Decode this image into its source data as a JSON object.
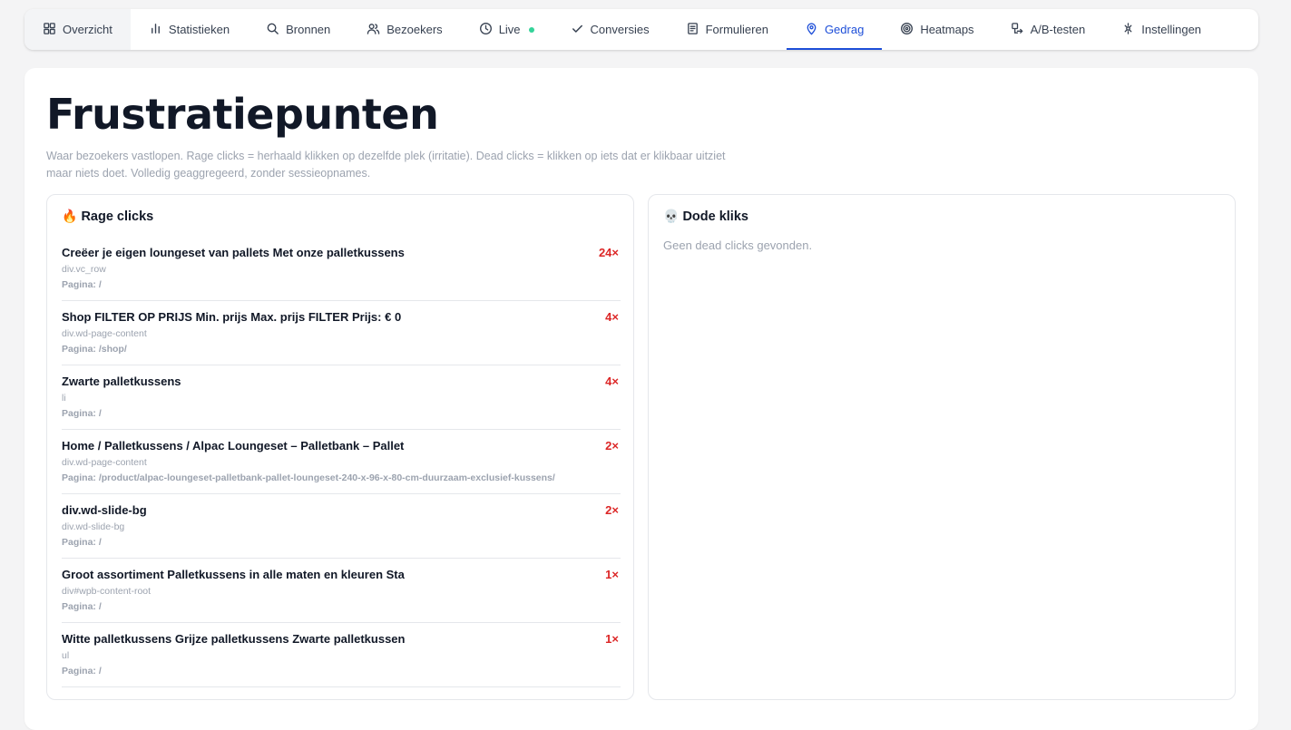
{
  "nav": {
    "tabs": [
      {
        "label": "Overzicht",
        "icon": "grid-icon"
      },
      {
        "label": "Statistieken",
        "icon": "bar-chart-icon"
      },
      {
        "label": "Bronnen",
        "icon": "search-icon"
      },
      {
        "label": "Bezoekers",
        "icon": "users-icon"
      },
      {
        "label": "Live",
        "icon": "clock-icon"
      },
      {
        "label": "Conversies",
        "icon": "check-icon"
      },
      {
        "label": "Formulieren",
        "icon": "form-icon"
      },
      {
        "label": "Gedrag",
        "icon": "map-pin-icon"
      },
      {
        "label": "Heatmaps",
        "icon": "target-icon"
      },
      {
        "label": "A/B-testen",
        "icon": "ab-test-icon"
      },
      {
        "label": "Instellingen",
        "icon": "settings-icon"
      }
    ],
    "active": "Gedrag"
  },
  "page": {
    "title": "Frustratiepunten",
    "description": "Waar bezoekers vastlopen. Rage clicks = herhaald klikken op dezelfde plek (irritatie). Dead clicks = klikken op iets dat er klikbaar uitziet maar niets doet. Volledig geaggregeerd, zonder sessieopnames."
  },
  "rage": {
    "emoji": "🔥",
    "title": "Rage clicks",
    "items": [
      {
        "text": "Creëer je eigen loungeset van pallets Met onze palletkussens",
        "selector": "div.vc_row",
        "page": "Pagina: /",
        "count": "24×"
      },
      {
        "text": "Shop FILTER OP PRIJS Min. prijs Max. prijs FILTER Prijs: € 0",
        "selector": "div.wd-page-content",
        "page": "Pagina: /shop/",
        "count": "4×"
      },
      {
        "text": "Zwarte palletkussens",
        "selector": "li",
        "page": "Pagina: /",
        "count": "4×"
      },
      {
        "text": "Home / Palletkussens / Alpac Loungeset – Palletbank – Pallet",
        "selector": "div.wd-page-content",
        "page": "Pagina: /product/alpac-loungeset-palletbank-pallet-loungeset-240-x-96-x-80-cm-duurzaam-exclusief-kussens/",
        "count": "2×"
      },
      {
        "text": "div.wd-slide-bg",
        "selector": "div.wd-slide-bg",
        "page": "Pagina: /",
        "count": "2×"
      },
      {
        "text": "Groot assortiment Palletkussens in alle maten en kleuren Sta",
        "selector": "div#wpb-content-root",
        "page": "Pagina: /",
        "count": "1×"
      },
      {
        "text": "Witte palletkussens Grijze palletkussens Zwarte palletkussen",
        "selector": "ul",
        "page": "Pagina: /",
        "count": "1×"
      }
    ]
  },
  "dead": {
    "emoji": "💀",
    "title": "Dode kliks",
    "empty": "Geen dead clicks gevonden."
  },
  "colors": {
    "accent": "#1d4ed8",
    "count": "#dc2626",
    "live_dot": "#34d399"
  }
}
